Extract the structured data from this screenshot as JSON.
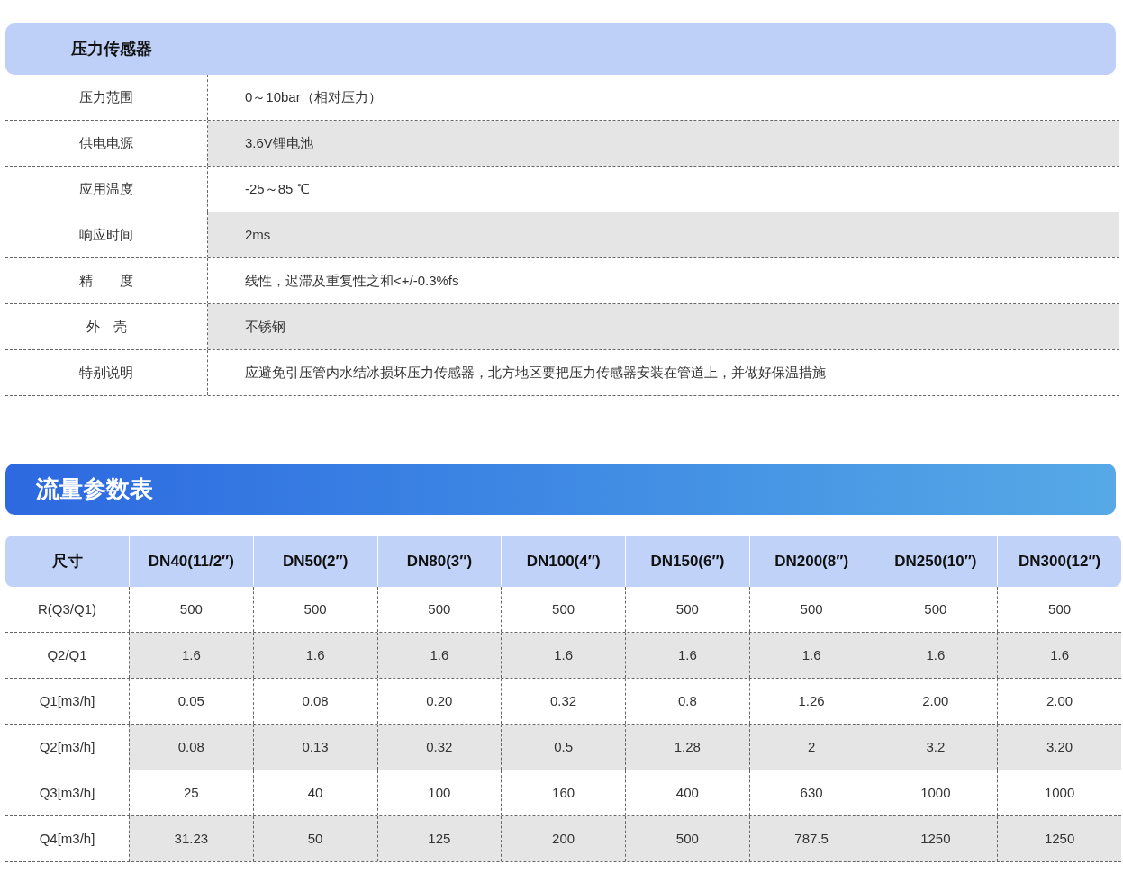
{
  "pressure_sensor": {
    "title": "压力传感器",
    "rows": [
      {
        "label": "压力范围",
        "value": "0～10bar（相对压力）",
        "shaded": false
      },
      {
        "label": "供电电源",
        "value": "3.6V锂电池",
        "shaded": true
      },
      {
        "label": "应用温度",
        "value": "-25～85 ℃",
        "shaded": false
      },
      {
        "label": "响应时间",
        "value": "2ms",
        "shaded": true
      },
      {
        "label": "精　　度",
        "value": "线性，迟滞及重复性之和<+/-0.3%fs",
        "shaded": false
      },
      {
        "label": "外　壳",
        "value": "不锈钢",
        "shaded": true
      },
      {
        "label": "特别说明",
        "value": "应避免引压管内水结冰损坏压力传感器，北方地区要把压力传感器安装在管道上，并做好保温措施",
        "shaded": false
      }
    ]
  },
  "flow_table": {
    "title": "流量参数表",
    "columns": [
      "尺寸",
      "DN40(11/2″)",
      "DN50(2″)",
      "DN80(3″)",
      "DN100(4″)",
      "DN150(6″)",
      "DN200(8″)",
      "DN250(10″)",
      "DN300(12″)"
    ],
    "rows": [
      {
        "cells": [
          "R(Q3/Q1)",
          "500",
          "500",
          "500",
          "500",
          "500",
          "500",
          "500",
          "500"
        ],
        "shaded": false
      },
      {
        "cells": [
          "Q2/Q1",
          "1.6",
          "1.6",
          "1.6",
          "1.6",
          "1.6",
          "1.6",
          "1.6",
          "1.6"
        ],
        "shaded": true
      },
      {
        "cells": [
          "Q1[m3/h]",
          "0.05",
          "0.08",
          "0.20",
          "0.32",
          "0.8",
          "1.26",
          "2.00",
          "2.00"
        ],
        "shaded": false
      },
      {
        "cells": [
          "Q2[m3/h]",
          "0.08",
          "0.13",
          "0.32",
          "0.5",
          "1.28",
          "2",
          "3.2",
          "3.20"
        ],
        "shaded": true
      },
      {
        "cells": [
          "Q3[m3/h]",
          "25",
          "40",
          "100",
          "160",
          "400",
          "630",
          "1000",
          "1000"
        ],
        "shaded": false
      },
      {
        "cells": [
          "Q4[m3/h]",
          "31.23",
          "50",
          "125",
          "200",
          "500",
          "787.5",
          "1250",
          "1250"
        ],
        "shaded": true
      }
    ]
  }
}
